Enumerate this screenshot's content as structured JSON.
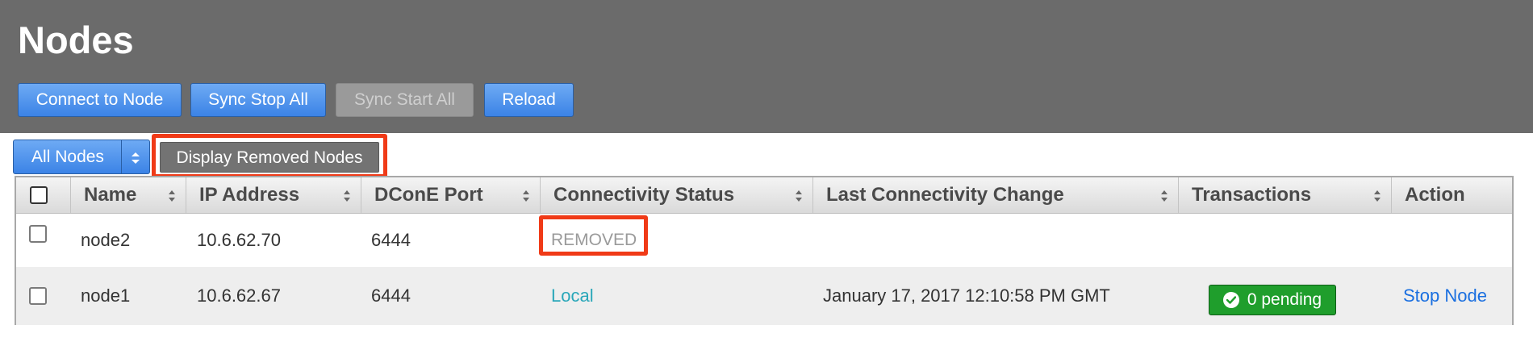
{
  "page": {
    "title": "Nodes"
  },
  "toolbar": {
    "buttons": [
      {
        "label": "Connect to Node",
        "enabled": true
      },
      {
        "label": "Sync Stop All",
        "enabled": true
      },
      {
        "label": "Sync Start All",
        "enabled": false
      },
      {
        "label": "Reload",
        "enabled": true
      }
    ]
  },
  "filter": {
    "selected": "All Nodes",
    "display_removed_label": "Display Removed Nodes"
  },
  "table": {
    "columns": [
      "Name",
      "IP Address",
      "DConE Port",
      "Connectivity Status",
      "Last Connectivity Change",
      "Transactions",
      "Action"
    ],
    "rows": [
      {
        "name": "node2",
        "ip": "10.6.62.70",
        "port": "6444",
        "status": "REMOVED",
        "last_change": "",
        "transactions": "",
        "action": ""
      },
      {
        "name": "node1",
        "ip": "10.6.62.67",
        "port": "6444",
        "status": "Local",
        "last_change": "January 17, 2017 12:10:58 PM GMT",
        "transactions": "0 pending",
        "action": "Stop Node"
      }
    ]
  },
  "colors": {
    "header_bg": "#6b6b6b",
    "button_blue": "#3b83e6",
    "highlight_red": "#f03a17",
    "status_local": "#2aa7b9",
    "status_removed": "#9a9a9a",
    "pending_green": "#1f9e2c",
    "link_blue": "#1a6fe0"
  }
}
